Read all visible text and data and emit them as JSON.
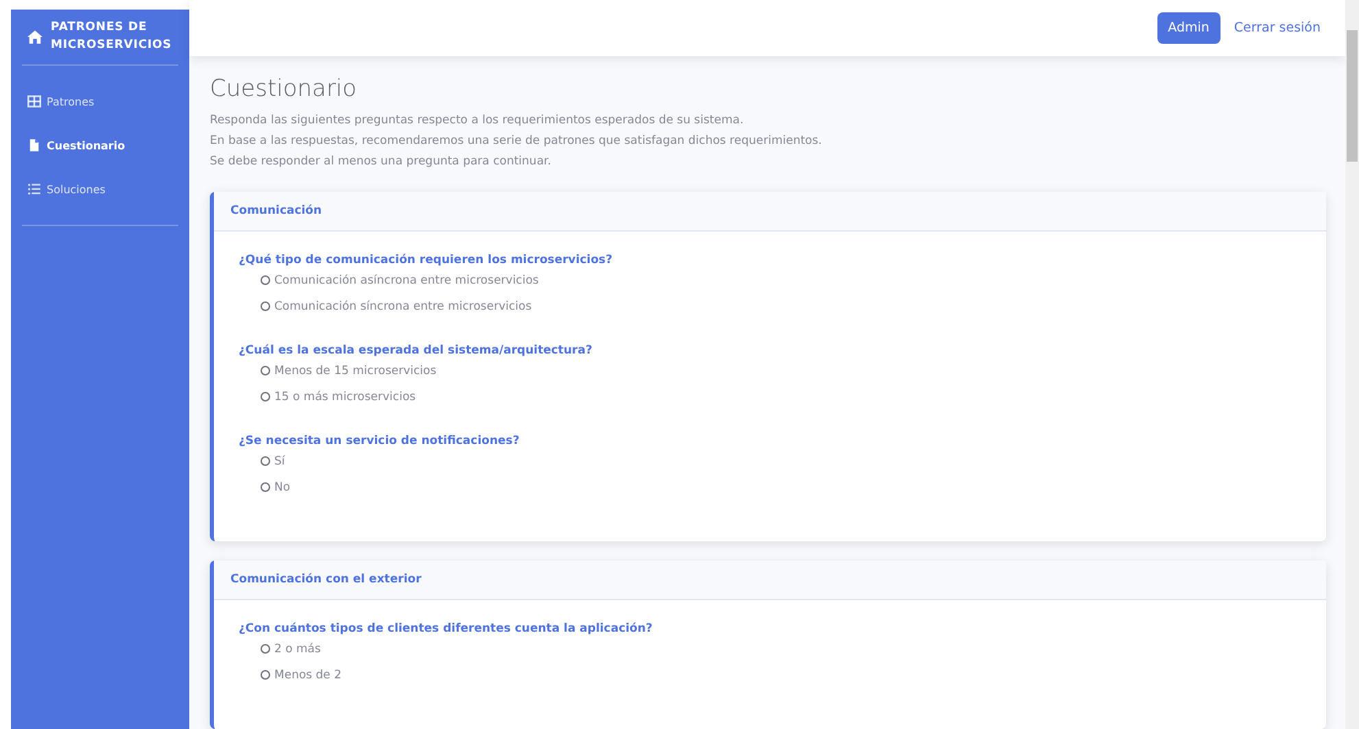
{
  "sidebar": {
    "brand": "PATRONES DE MICROSERVICIOS",
    "items": [
      {
        "label": "Patrones",
        "selected": false
      },
      {
        "label": "Cuestionario",
        "selected": true
      },
      {
        "label": "Soluciones",
        "selected": false
      }
    ]
  },
  "topbar": {
    "user_button": "Admin",
    "logout_link": "Cerrar sesión"
  },
  "page": {
    "title": "Cuestionario",
    "intro": [
      "Responda las siguientes preguntas respecto a los requerimientos esperados de su sistema.",
      "En base a las respuestas, recomendaremos una serie de patrones que satisfagan dichos requerimientos.",
      "Se debe responder al menos una pregunta para continuar."
    ]
  },
  "sections": [
    {
      "title": "Comunicación",
      "questions": [
        {
          "text": "¿Qué tipo de comunicación requieren los microservicios?",
          "options": [
            {
              "label": "Comunicación asíncrona entre microservicios",
              "selected": false
            },
            {
              "label": "Comunicación síncrona entre microservicios",
              "selected": false
            }
          ]
        },
        {
          "text": "¿Cuál es la escala esperada del sistema/arquitectura?",
          "options": [
            {
              "label": "Menos de 15 microservicios",
              "selected": false
            },
            {
              "label": "15 o más microservicios",
              "selected": false
            }
          ]
        },
        {
          "text": "¿Se necesita un servicio de notificaciones?",
          "options": [
            {
              "label": "Sí",
              "selected": false
            },
            {
              "label": "No",
              "selected": false
            }
          ]
        }
      ]
    },
    {
      "title": "Comunicación con el exterior",
      "questions": [
        {
          "text": "¿Con cuántos tipos de clientes diferentes cuenta la aplicación?",
          "options": [
            {
              "label": "2 o más",
              "selected": false
            },
            {
              "label": "Menos de 2",
              "selected": false
            }
          ]
        }
      ]
    }
  ]
}
